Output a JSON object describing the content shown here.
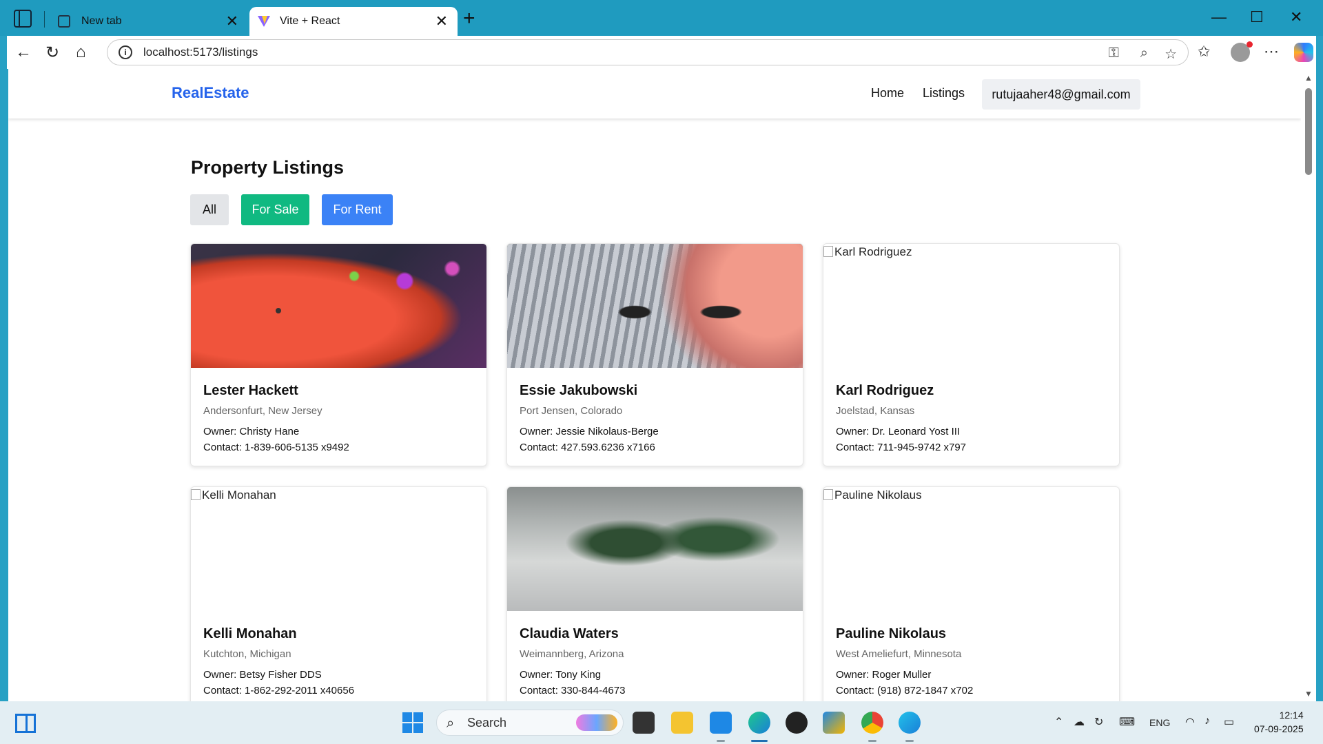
{
  "browser": {
    "tabs": [
      {
        "title": "New tab",
        "active": false
      },
      {
        "title": "Vite + React",
        "active": true
      }
    ],
    "url": "localhost:5173/listings"
  },
  "site": {
    "brand": "RealEstate",
    "nav": [
      "Home",
      "Listings"
    ],
    "user_email": "rutujaaher48@gmail.com",
    "accent_color": "#2563eb"
  },
  "page": {
    "title": "Property Listings",
    "filters": [
      {
        "label": "All",
        "color": "#e3e5e8"
      },
      {
        "label": "For Sale",
        "color": "#10b981"
      },
      {
        "label": "For Rent",
        "color": "#3b82f6"
      }
    ]
  },
  "listings": [
    {
      "name": "Lester Hackett",
      "location": "Andersonfurt, New Jersey",
      "owner": "Owner: Christy Hane",
      "contact": "Contact: 1-839-606-5135 x9492",
      "image": "red-umbrella-photo"
    },
    {
      "name": "Essie Jakubowski",
      "location": "Port Jensen, Colorado",
      "owner": "Owner: Jessie Nikolaus-Berge",
      "contact": "Contact: 427.593.6236 x7166",
      "image": "city-rooftop-feet-photo"
    },
    {
      "name": "Karl Rodriguez",
      "location": "Joelstad, Kansas",
      "owner": "Owner: Dr. Leonard Yost III",
      "contact": "Contact: 711-945-9742 x797",
      "image_alt": "Karl Rodriguez"
    },
    {
      "name": "Kelli Monahan",
      "location": "Kutchton, Michigan",
      "owner": "Owner: Betsy Fisher DDS",
      "contact": "Contact: 1-862-292-2011 x40656",
      "image_alt": "Kelli Monahan"
    },
    {
      "name": "Claudia Waters",
      "location": "Weimannberg, Arizona",
      "owner": "Owner: Tony King",
      "contact": "Contact: 330-844-4673",
      "image": "foggy-forest-photo"
    },
    {
      "name": "Pauline Nikolaus",
      "location": "West Ameliefurt, Minnesota",
      "owner": "Owner: Roger Muller",
      "contact": "Contact: (918) 872-1847 x702",
      "image_alt": "Pauline Nikolaus"
    }
  ],
  "taskbar": {
    "search_label": "Search",
    "language": "ENG",
    "time": "12:14",
    "date": "07-09-2025"
  }
}
